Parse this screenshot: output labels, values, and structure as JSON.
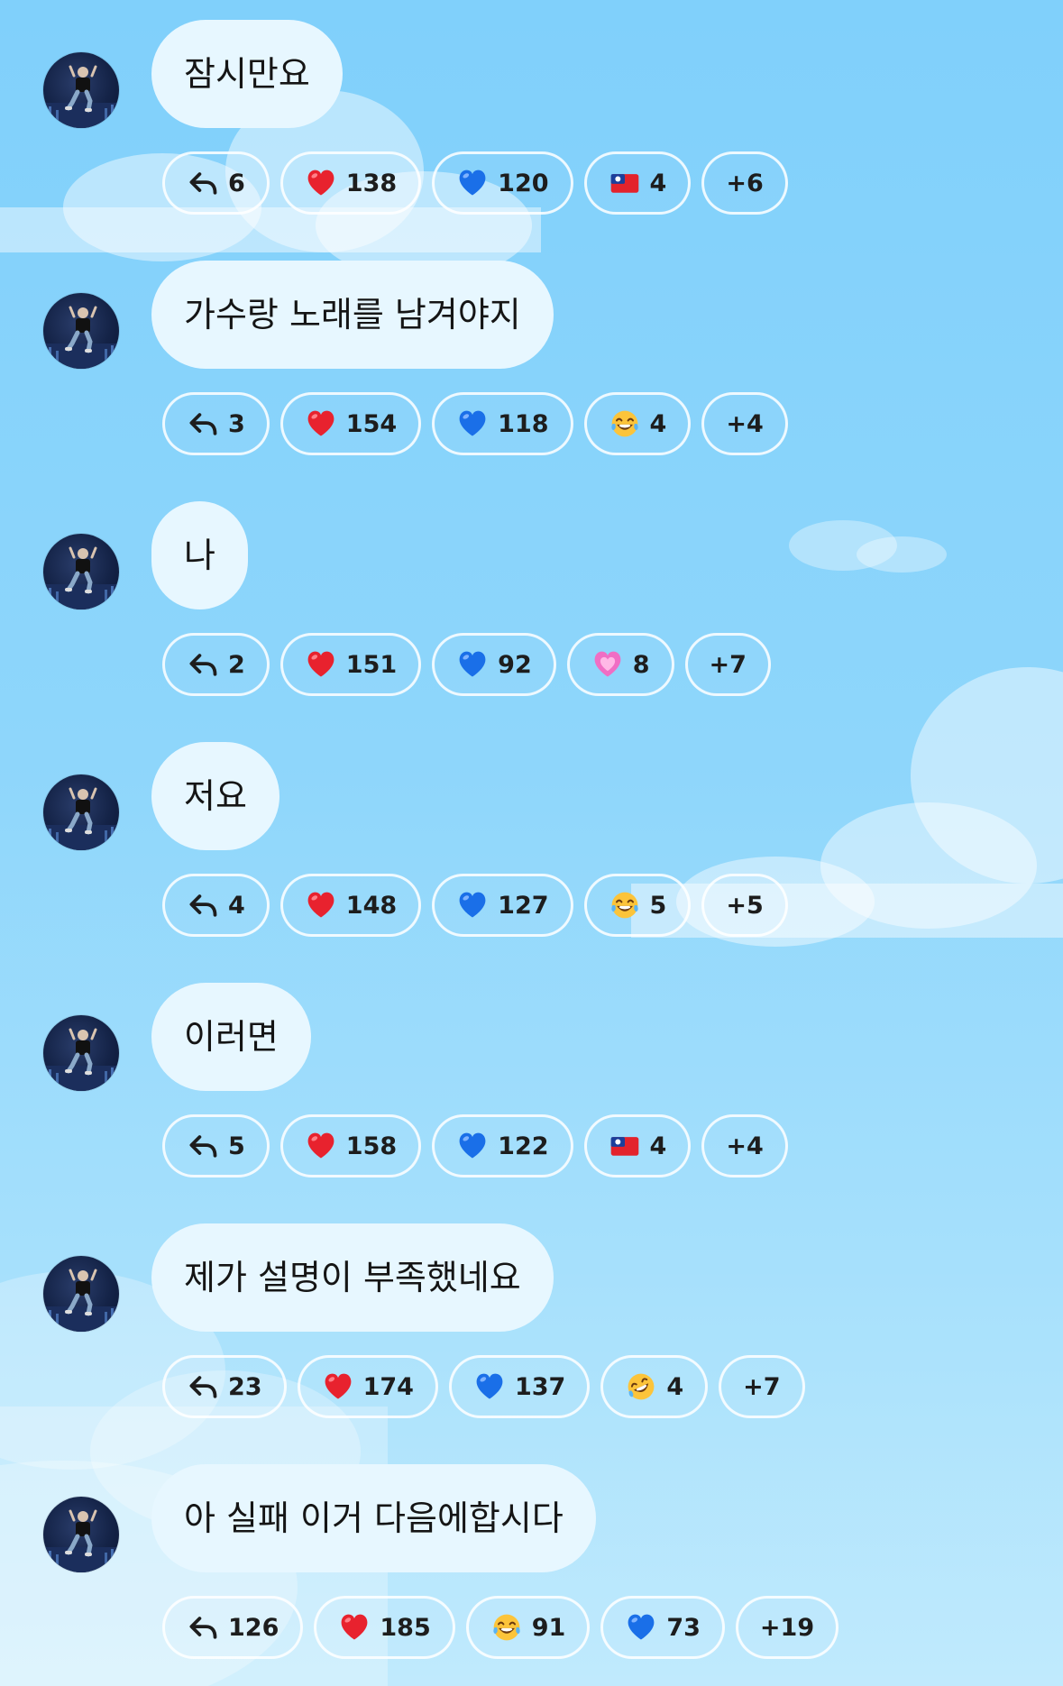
{
  "messages": [
    {
      "text": "잠시만요",
      "reactions": [
        {
          "icon": "reply-icon",
          "count": "6"
        },
        {
          "icon": "red-heart-icon",
          "count": "138"
        },
        {
          "icon": "blue-heart-icon",
          "count": "120"
        },
        {
          "icon": "taiwan-flag-icon",
          "count": "4"
        },
        {
          "icon": "",
          "count": "+6"
        }
      ]
    },
    {
      "text": "가수랑 노래를 남겨야지",
      "reactions": [
        {
          "icon": "reply-icon",
          "count": "3"
        },
        {
          "icon": "red-heart-icon",
          "count": "154"
        },
        {
          "icon": "blue-heart-icon",
          "count": "118"
        },
        {
          "icon": "tears-of-joy-icon",
          "count": "4"
        },
        {
          "icon": "",
          "count": "+4"
        }
      ]
    },
    {
      "text": "나",
      "reactions": [
        {
          "icon": "reply-icon",
          "count": "2"
        },
        {
          "icon": "red-heart-icon",
          "count": "151"
        },
        {
          "icon": "blue-heart-icon",
          "count": "92"
        },
        {
          "icon": "pink-heart-icon",
          "count": "8"
        },
        {
          "icon": "",
          "count": "+7"
        }
      ]
    },
    {
      "text": "저요",
      "reactions": [
        {
          "icon": "reply-icon",
          "count": "4"
        },
        {
          "icon": "red-heart-icon",
          "count": "148"
        },
        {
          "icon": "blue-heart-icon",
          "count": "127"
        },
        {
          "icon": "tears-of-joy-icon",
          "count": "5"
        },
        {
          "icon": "",
          "count": "+5"
        }
      ]
    },
    {
      "text": "이러면",
      "reactions": [
        {
          "icon": "reply-icon",
          "count": "5"
        },
        {
          "icon": "red-heart-icon",
          "count": "158"
        },
        {
          "icon": "blue-heart-icon",
          "count": "122"
        },
        {
          "icon": "taiwan-flag-icon",
          "count": "4"
        },
        {
          "icon": "",
          "count": "+4"
        }
      ]
    },
    {
      "text": "제가 설명이 부족했네요",
      "reactions": [
        {
          "icon": "reply-icon",
          "count": "23"
        },
        {
          "icon": "red-heart-icon",
          "count": "174"
        },
        {
          "icon": "blue-heart-icon",
          "count": "137"
        },
        {
          "icon": "rolling-laughing-icon",
          "count": "4"
        },
        {
          "icon": "",
          "count": "+7"
        }
      ]
    },
    {
      "text": "아 실패 이거 다음에합시다",
      "reactions": [
        {
          "icon": "reply-icon",
          "count": "126"
        },
        {
          "icon": "red-heart-icon",
          "count": "185"
        },
        {
          "icon": "tears-of-joy-icon",
          "count": "91"
        },
        {
          "icon": "blue-heart-icon",
          "count": "73"
        },
        {
          "icon": "",
          "count": "+19"
        }
      ]
    }
  ]
}
